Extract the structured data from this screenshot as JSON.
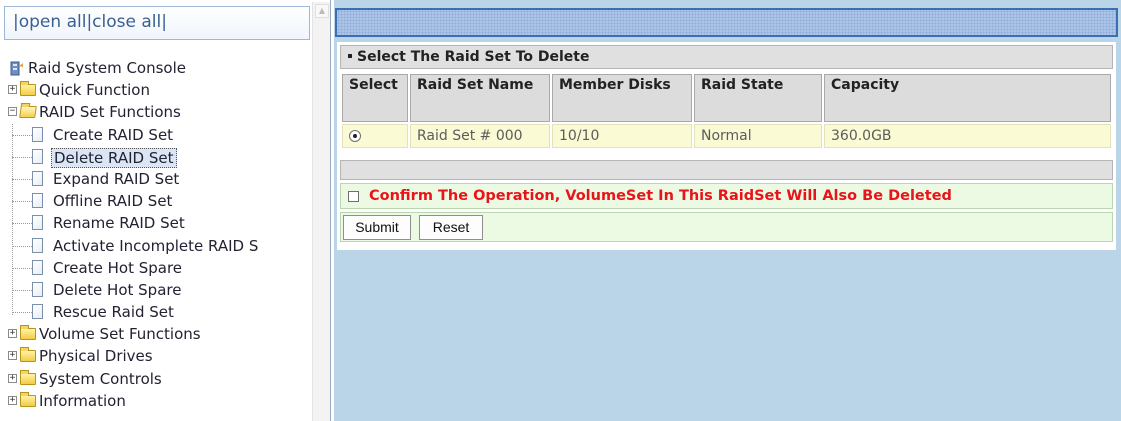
{
  "left": {
    "open_all": "open all",
    "close_all": "close all",
    "tree": {
      "root": "Raid System Console",
      "quick_function": "Quick Function",
      "raid_set_functions": "RAID Set Functions",
      "raid_items": [
        "Create RAID Set",
        "Delete RAID Set",
        "Expand RAID Set",
        "Offline RAID Set",
        "Rename RAID Set",
        "Activate Incomplete RAID S",
        "Create Hot Spare",
        "Delete Hot Spare",
        "Rescue Raid Set"
      ],
      "selected_item": "Delete RAID Set",
      "volume_set_functions": "Volume Set Functions",
      "physical_drives": "Physical Drives",
      "system_controls": "System Controls",
      "information": "Information"
    }
  },
  "main": {
    "section_title": "Select The Raid Set To Delete",
    "table": {
      "headers": [
        "Select",
        "Raid Set Name",
        "Member Disks",
        "Raid State",
        "Capacity"
      ],
      "rows": [
        {
          "selected": true,
          "name": "Raid Set # 000",
          "member_disks": "10/10",
          "state": "Normal",
          "capacity": "360.0GB"
        }
      ]
    },
    "confirm_checked": false,
    "confirm_label": "Confirm The Operation, VolumeSet In This RaidSet Will Also Be Deleted",
    "submit_label": "Submit",
    "reset_label": "Reset"
  },
  "colors": {
    "confirm_text": "#e8141a",
    "row_highlight": "#fafad4",
    "form_bar": "#ecfae4",
    "frame_bg": "#bad5e7"
  }
}
